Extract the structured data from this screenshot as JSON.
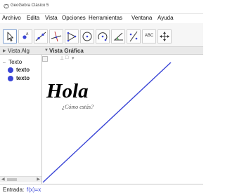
{
  "titlebar": {
    "title": "GeoGebra Clásico 5"
  },
  "menu": [
    "Archivo",
    "Edita",
    "Vista",
    "Opciones",
    "Herramientas",
    "Ventana",
    "Ayuda"
  ],
  "toolbar": {
    "tools": [
      {
        "name": "move-tool",
        "icon": "arrow-icon"
      },
      {
        "name": "point-tool",
        "icon": "point-icon"
      },
      {
        "name": "line-tool",
        "icon": "line-icon"
      },
      {
        "name": "perpendicular-tool",
        "icon": "perpendicular-icon"
      },
      {
        "name": "polygon-tool",
        "icon": "polygon-icon"
      },
      {
        "name": "circle-tool",
        "icon": "circle-icon"
      },
      {
        "name": "arc-tool",
        "icon": "arc-icon"
      },
      {
        "name": "angle-tool",
        "icon": "angle-icon"
      },
      {
        "name": "reflect-tool",
        "icon": "reflect-icon"
      },
      {
        "name": "text-tool",
        "icon": "text-icon",
        "label": "ABC"
      },
      {
        "name": "move-view-tool",
        "icon": "move-view-icon"
      }
    ]
  },
  "algebra": {
    "header": "Vista Alg",
    "group": "Texto",
    "items": [
      "texto",
      "texto"
    ],
    "object_color": "#3a45d6"
  },
  "graphics": {
    "header": "Vista Gráfica",
    "texts": {
      "main": "Hola",
      "subtitle": "¿Cómo estás?"
    },
    "line_color": "#3a45d6"
  },
  "input": {
    "label": "Entrada:",
    "value": "f(x)=x"
  },
  "colors": {
    "accent": "#3a45d6",
    "toolbar_bg": "#f6f6f6",
    "header_bg": "#e9e9e9"
  }
}
